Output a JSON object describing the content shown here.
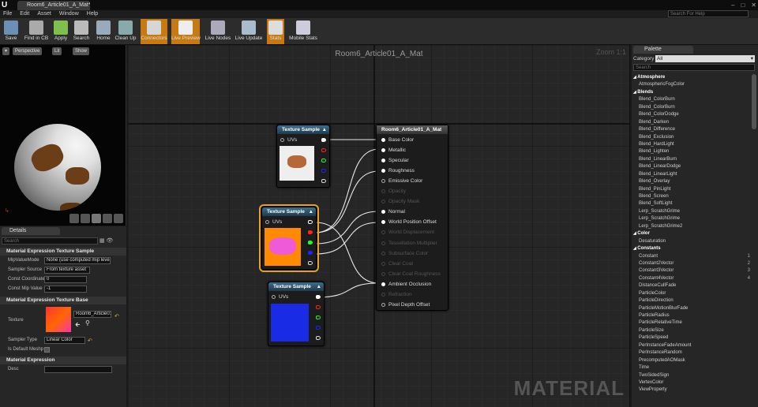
{
  "window": {
    "tab_title": "Room6_Article01_A_Mat*",
    "help_search_placeholder": "Search For Help"
  },
  "menu": [
    "File",
    "Edit",
    "Asset",
    "Window",
    "Help"
  ],
  "toolbar": [
    {
      "label": "Save",
      "icon": "save-icon",
      "active": false
    },
    {
      "label": "Find in CB",
      "icon": "find-icon",
      "active": false
    },
    {
      "label": "Apply",
      "icon": "apply-icon",
      "active": false
    },
    {
      "label": "Search",
      "icon": "search-icon",
      "active": false
    },
    {
      "label": "Home",
      "icon": "home-icon",
      "active": false
    },
    {
      "label": "Clean Up",
      "icon": "cleanup-icon",
      "active": false
    },
    {
      "label": "Connectors",
      "icon": "connectors-icon",
      "active": true
    },
    {
      "label": "Live Preview",
      "icon": "live-preview-icon",
      "active": true
    },
    {
      "label": "Live Nodes",
      "icon": "live-nodes-icon",
      "active": false
    },
    {
      "label": "Live Update",
      "icon": "live-update-icon",
      "active": false
    },
    {
      "label": "Stats",
      "icon": "stats-icon",
      "active": true
    },
    {
      "label": "Mobile Stats",
      "icon": "mobile-stats-icon",
      "active": false
    }
  ],
  "viewport": {
    "perspective": "Perspective",
    "lit": "Lit",
    "show": "Show"
  },
  "details": {
    "tab": "Details",
    "search_placeholder": "Search",
    "section1": "Material Expression Texture Sample",
    "mip_value_mode_label": "MipValueMode",
    "mip_value_mode": "None (use computed mip level)",
    "sampler_source_label": "Sampler Source",
    "sampler_source": "From texture asset",
    "const_coordinate_label": "Const Coordinate",
    "const_coordinate": "0",
    "const_mip_label": "Const Mip Value",
    "const_mip": "-1",
    "section2": "Material Expression Texture Base",
    "texture_label": "Texture",
    "texture_value": "Room6_Article01",
    "sampler_type_label": "Sampler Type",
    "sampler_type": "Linear Color",
    "is_default_meshpaint_label": "Is Default Meshp",
    "section3": "Material Expression",
    "desc_label": "Desc"
  },
  "graph": {
    "title": "Room6_Article01_A_Mat",
    "zoom": "Zoom 1:1",
    "watermark": "MATERIAL",
    "texture_node_title": "Texture Sample",
    "uvs_label": "UVs",
    "material_node": {
      "title": "Room6_Article01_A_Mat",
      "pins": [
        {
          "label": "Base Color",
          "enabled": true
        },
        {
          "label": "Metallic",
          "enabled": true
        },
        {
          "label": "Specular",
          "enabled": true
        },
        {
          "label": "Roughness",
          "enabled": true
        },
        {
          "label": "Emissive Color",
          "enabled": true
        },
        {
          "label": "Opacity",
          "enabled": false
        },
        {
          "label": "Opacity Mask",
          "enabled": false
        },
        {
          "label": "Normal",
          "enabled": true
        },
        {
          "label": "World Position Offset",
          "enabled": true
        },
        {
          "label": "World Displacement",
          "enabled": false
        },
        {
          "label": "Tessellation Multiplier",
          "enabled": false
        },
        {
          "label": "Subsurface Color",
          "enabled": false
        },
        {
          "label": "Clear Coat",
          "enabled": false
        },
        {
          "label": "Clear Coat Roughness",
          "enabled": false
        },
        {
          "label": "Ambient Occlusion",
          "enabled": true
        },
        {
          "label": "Refraction",
          "enabled": false
        },
        {
          "label": "Pixel Depth Offset",
          "enabled": true
        }
      ]
    }
  },
  "palette": {
    "tab": "Palette",
    "category_label": "Category",
    "category_value": "All",
    "search_placeholder": "Search",
    "items": [
      {
        "label": "Atmosphere",
        "cat": true,
        "hk": ""
      },
      {
        "label": "AtmosphericFogColor",
        "cat": false,
        "hk": ""
      },
      {
        "label": "Blends",
        "cat": true,
        "hk": ""
      },
      {
        "label": "Blend_ColorBurn",
        "cat": false,
        "hk": ""
      },
      {
        "label": "Blend_ColorBurn",
        "cat": false,
        "hk": ""
      },
      {
        "label": "Blend_ColorDodge",
        "cat": false,
        "hk": ""
      },
      {
        "label": "Blend_Darken",
        "cat": false,
        "hk": ""
      },
      {
        "label": "Blend_Difference",
        "cat": false,
        "hk": ""
      },
      {
        "label": "Blend_Exclusion",
        "cat": false,
        "hk": ""
      },
      {
        "label": "Blend_HardLight",
        "cat": false,
        "hk": ""
      },
      {
        "label": "Blend_Lighten",
        "cat": false,
        "hk": ""
      },
      {
        "label": "Blend_LinearBurn",
        "cat": false,
        "hk": ""
      },
      {
        "label": "Blend_LinearDodge",
        "cat": false,
        "hk": ""
      },
      {
        "label": "Blend_LinearLight",
        "cat": false,
        "hk": ""
      },
      {
        "label": "Blend_Overlay",
        "cat": false,
        "hk": ""
      },
      {
        "label": "Blend_PinLight",
        "cat": false,
        "hk": ""
      },
      {
        "label": "Blend_Screen",
        "cat": false,
        "hk": ""
      },
      {
        "label": "Blend_SoftLight",
        "cat": false,
        "hk": ""
      },
      {
        "label": "Lerp_ScratchGrime",
        "cat": false,
        "hk": ""
      },
      {
        "label": "Lerp_ScratchGrime",
        "cat": false,
        "hk": ""
      },
      {
        "label": "Lerp_ScratchGrime2",
        "cat": false,
        "hk": ""
      },
      {
        "label": "Color",
        "cat": true,
        "hk": ""
      },
      {
        "label": "Desaturation",
        "cat": false,
        "hk": ""
      },
      {
        "label": "Constants",
        "cat": true,
        "hk": ""
      },
      {
        "label": "Constant",
        "cat": false,
        "hk": "1"
      },
      {
        "label": "Constant2Vector",
        "cat": false,
        "hk": "2"
      },
      {
        "label": "Constant3Vector",
        "cat": false,
        "hk": "3"
      },
      {
        "label": "Constant4Vector",
        "cat": false,
        "hk": "4"
      },
      {
        "label": "DistanceCullFade",
        "cat": false,
        "hk": ""
      },
      {
        "label": "ParticleColor",
        "cat": false,
        "hk": ""
      },
      {
        "label": "ParticleDirection",
        "cat": false,
        "hk": ""
      },
      {
        "label": "ParticleMotionBlurFade",
        "cat": false,
        "hk": ""
      },
      {
        "label": "ParticleRadius",
        "cat": false,
        "hk": ""
      },
      {
        "label": "ParticleRelativeTime",
        "cat": false,
        "hk": ""
      },
      {
        "label": "ParticleSize",
        "cat": false,
        "hk": ""
      },
      {
        "label": "ParticleSpeed",
        "cat": false,
        "hk": ""
      },
      {
        "label": "PerInstanceFadeAmount",
        "cat": false,
        "hk": ""
      },
      {
        "label": "PerInstanceRandom",
        "cat": false,
        "hk": ""
      },
      {
        "label": "PrecomputedAOMask",
        "cat": false,
        "hk": ""
      },
      {
        "label": "Time",
        "cat": false,
        "hk": ""
      },
      {
        "label": "TwoSidedSign",
        "cat": false,
        "hk": ""
      },
      {
        "label": "VertexColor",
        "cat": false,
        "hk": ""
      },
      {
        "label": "ViewProperty",
        "cat": false,
        "hk": ""
      }
    ]
  },
  "colors": {
    "accent": "#c77a12",
    "node_header": "#2f5f7d",
    "selection": "#e6a02a"
  }
}
